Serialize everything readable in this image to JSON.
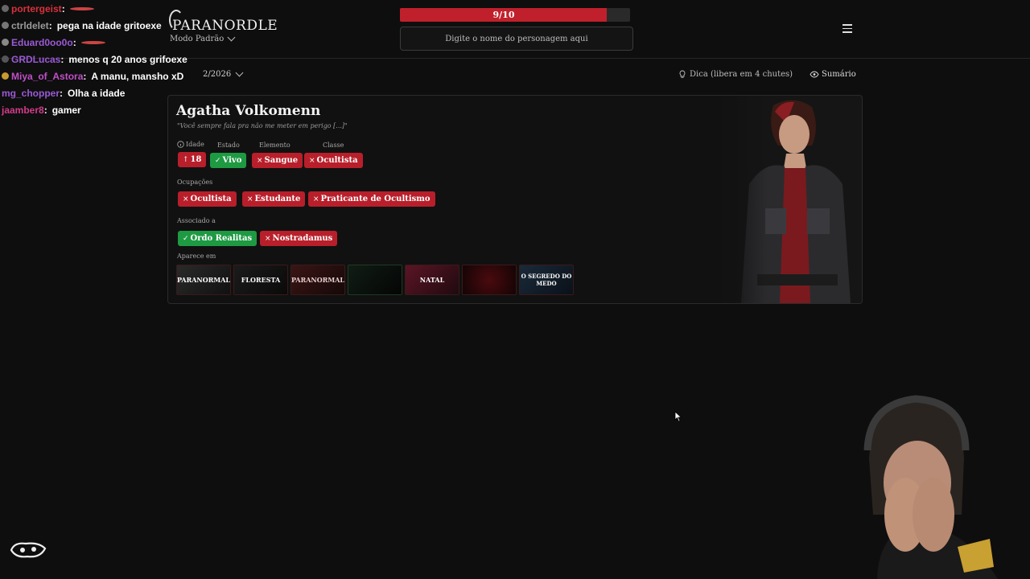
{
  "header": {
    "logo": "PARANORDLE",
    "mode_label": "Modo Padrão",
    "progress_text": "9/10",
    "progress_value": 0.9,
    "search_placeholder": "Digite o nome do personagem aqui"
  },
  "subheader": {
    "date": "2/2026",
    "hint": "Dica (libera em 4 chutes)",
    "summary": "Sumário"
  },
  "character": {
    "name": "Agatha Volkomenn",
    "quote": "\"Você sempre fala pra não me meter em perigo [...]\"",
    "labels": {
      "age": "Idade",
      "state": "Estado",
      "element": "Elemento",
      "class": "Classe",
      "occupations": "Ocupações",
      "associated": "Associado a",
      "appears": "Aparece em"
    },
    "attributes": {
      "age": {
        "mark": "↑",
        "value": "18"
      },
      "state": {
        "mark": "✓",
        "value": "Vivo"
      },
      "element": {
        "mark": "×",
        "value": "Sangue"
      },
      "class": {
        "mark": "×",
        "value": "Ocultista"
      }
    },
    "occupations": [
      {
        "mark": "×",
        "value": "Ocultista"
      },
      {
        "mark": "×",
        "value": "Estudante"
      },
      {
        "mark": "×",
        "value": "Praticante de Ocultismo"
      }
    ],
    "associated": [
      {
        "mark": "✓",
        "value": "Ordo Realitas"
      },
      {
        "mark": "×",
        "value": "Nostradamus"
      }
    ],
    "appears_in": [
      "PARANORMAL",
      "FLORESTA",
      "PARANORMAL",
      "",
      "NATAL",
      "",
      "O SEGREDO DO MEDO"
    ]
  },
  "chat": [
    {
      "user": "portergeist",
      "color": "#d9303c",
      "text": ""
    },
    {
      "user": "ctrldelet",
      "color": "#9a9a9a",
      "text": "pega na idade gritoexe"
    },
    {
      "user": "Eduard0oo0o",
      "color": "#9b59d6",
      "text": ""
    },
    {
      "user": "GRDLucas",
      "color": "#9b59d6",
      "text": "menos q 20 anos grifoexe"
    },
    {
      "user": "Miya_of_Astora",
      "color": "#c050c8",
      "text": "A manu, mansho xD"
    },
    {
      "user": "mg_chopper",
      "color": "#9b59d6",
      "text": "Olha a idade"
    },
    {
      "user": "jaamber8",
      "color": "#d23b8a",
      "text": "gamer"
    }
  ]
}
